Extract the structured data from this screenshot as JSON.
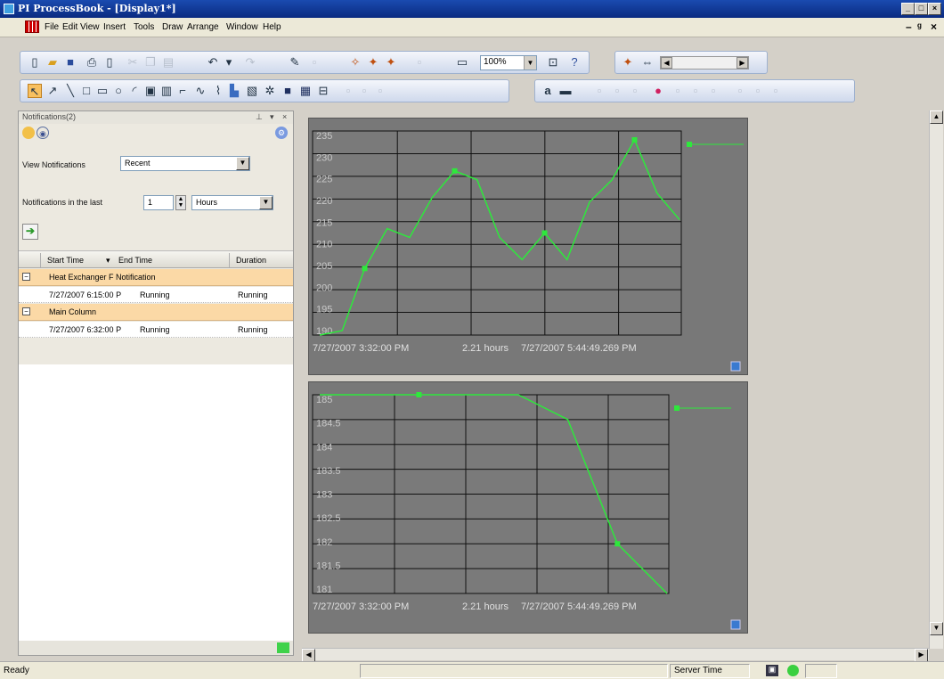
{
  "window": {
    "title": "PI ProcessBook - [Display1*]"
  },
  "menu": [
    "File",
    "Edit",
    "View",
    "Insert",
    "Tools",
    "Draw",
    "Arrange",
    "Window",
    "Help"
  ],
  "toolbar": {
    "zoom": "100%"
  },
  "drawing_toolbar": {
    "text_tool": "a"
  },
  "notifications": {
    "panel_title": "Notifications(2)",
    "view_label": "View Notifications",
    "view_value": "Recent",
    "last_label": "Notifications in the last",
    "last_value": "1",
    "unit_value": "Hours",
    "columns": [
      "Start Time",
      "End Time",
      "Duration"
    ],
    "groups": [
      {
        "name": "Heat Exchanger F Notification",
        "start": "7/27/2007 6:15:00 P",
        "end": "Running",
        "duration": "Running"
      },
      {
        "name": "Main Column",
        "start": "7/27/2007 6:32:00 P",
        "end": "Running",
        "duration": "Running"
      }
    ]
  },
  "trends": [
    {
      "y_ticks": [
        "235",
        "230",
        "225",
        "220",
        "215",
        "210",
        "205",
        "200",
        "195",
        "190"
      ],
      "ylim": [
        190,
        236
      ],
      "series": [
        {
          "values": [
            190,
            191,
            205,
            214,
            212,
            221,
            227,
            225,
            212,
            207,
            213,
            207,
            220,
            225,
            234,
            222,
            216
          ]
        }
      ],
      "start_time": "7/27/2007 3:32:00 PM",
      "span": "2.21 hours",
      "end_time": "7/27/2007 5:44:49.269 PM",
      "color": "#2ee83c"
    },
    {
      "y_ticks": [
        "185",
        "184.5",
        "184",
        "183.5",
        "183",
        "182.5",
        "182",
        "181.5",
        "181"
      ],
      "ylim": [
        181,
        185
      ],
      "series": [
        {
          "values": [
            185,
            185,
            185,
            185,
            185,
            184.5,
            182,
            181
          ]
        }
      ],
      "start_time": "7/27/2007 3:32:00 PM",
      "span": "2.21 hours",
      "end_time": "7/27/2007 5:44:49.269 PM",
      "color": "#2ee83c"
    }
  ],
  "status": {
    "ready": "Ready",
    "server_time": "Server Time"
  }
}
